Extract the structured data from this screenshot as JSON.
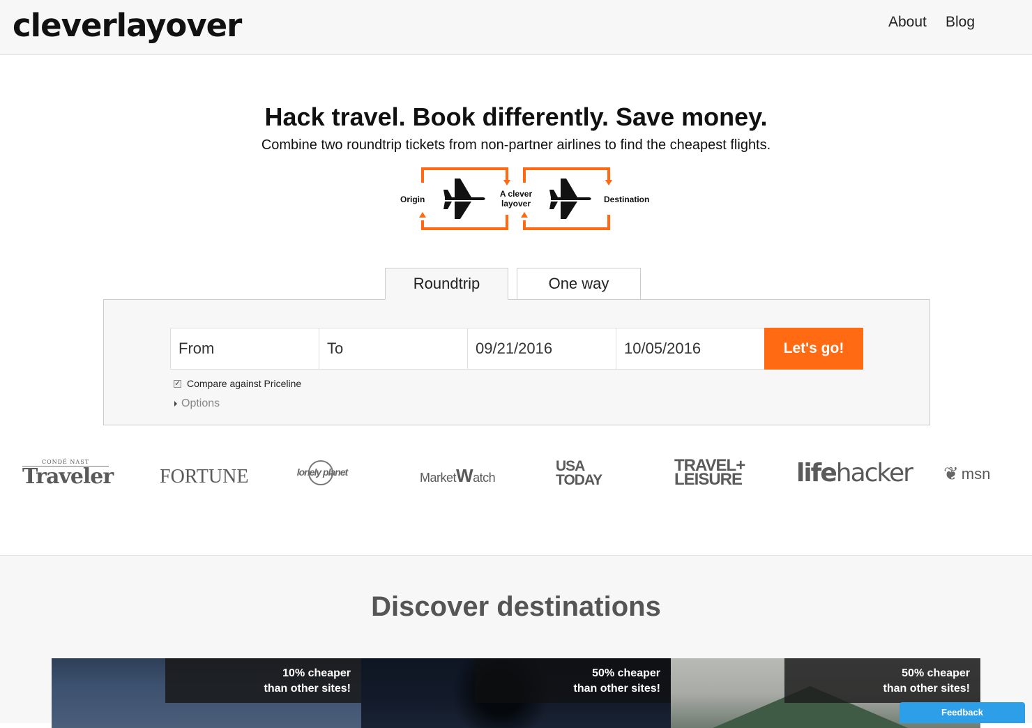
{
  "header": {
    "logo": "cleverlayover",
    "nav": {
      "about": "About",
      "blog": "Blog"
    }
  },
  "hero": {
    "title": "Hack travel. Book differently. Save money.",
    "subtitle": "Combine two roundtrip tickets from non-partner airlines to find the cheapest flights."
  },
  "diagram": {
    "origin": "Origin",
    "layover_line1": "A clever",
    "layover_line2": "layover",
    "destination": "Destination",
    "accent_color": "#ff6a13"
  },
  "search": {
    "tabs": {
      "roundtrip": "Roundtrip",
      "oneway": "One way"
    },
    "from_placeholder": "From",
    "to_placeholder": "To",
    "depart_date": "09/21/2016",
    "return_date": "10/05/2016",
    "submit_label": "Let's go!",
    "compare_label": "Compare against Priceline",
    "compare_checked": true,
    "options_label": "Options"
  },
  "press": {
    "traveler_small": "CONDÉ NAST",
    "traveler_big": "Traveler",
    "fortune": "FORTUNE",
    "lonely": "lonely planet",
    "market_a": "Market",
    "market_w": "W",
    "market_b": "atch",
    "usa_1": "USA",
    "usa_2": "TODAY",
    "tl_1": "TRAVEL+",
    "tl_2": "LEISURE",
    "life_a": "life",
    "life_b": "hacker",
    "msn": "msn"
  },
  "discover": {
    "title": "Discover destinations",
    "cards": [
      {
        "line1": "10% cheaper",
        "line2": "than other sites!"
      },
      {
        "line1": "50% cheaper",
        "line2": "than other sites!"
      },
      {
        "line1": "50% cheaper",
        "line2": "than other sites!"
      }
    ]
  },
  "feedback": {
    "label": "Feedback"
  }
}
